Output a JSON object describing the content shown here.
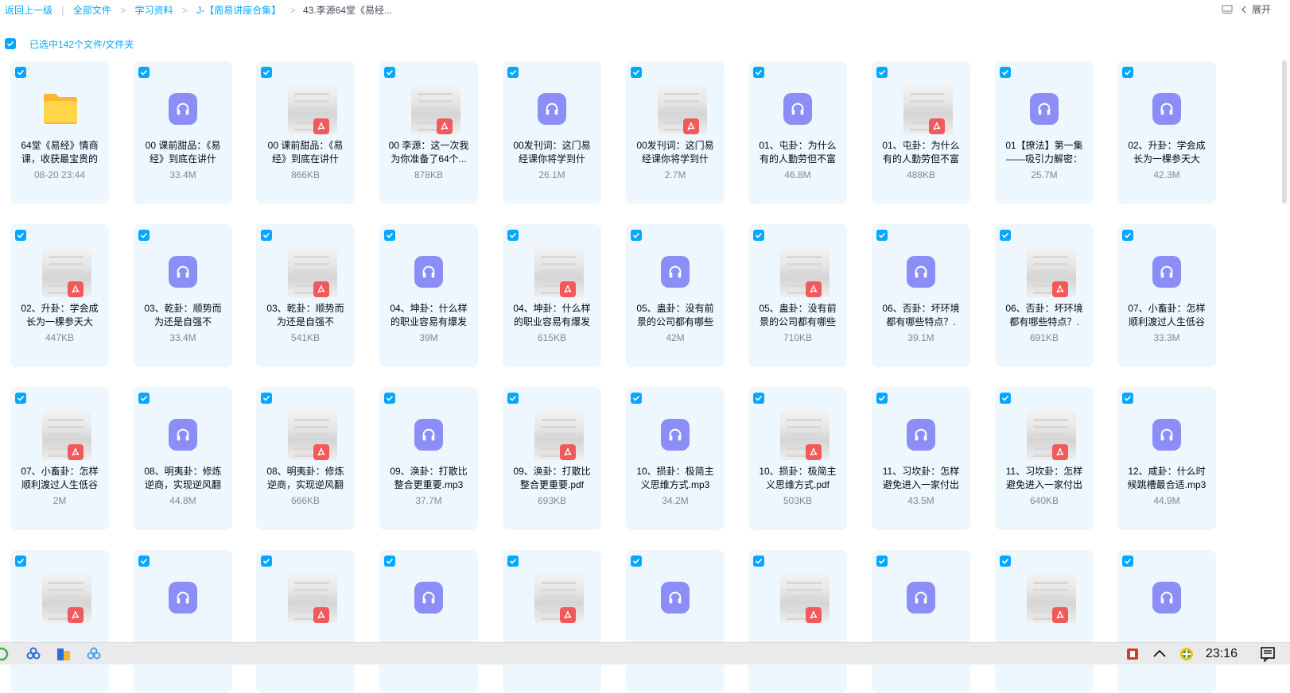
{
  "breadcrumb": {
    "back": "返回上一级",
    "items": [
      "全部文件",
      "学习资料",
      "J-【周易讲座合集】"
    ],
    "current": "43.李源64堂《易经..."
  },
  "top_right": {
    "collapse_label": "展开"
  },
  "selection": {
    "text": "已选中142个文件/文件夹"
  },
  "colors": {
    "accent": "#06a7ff",
    "card_bg": "#eef7fe",
    "audio_icon": "#8a8ef6",
    "pdf": "#f15a5a",
    "folder": "#ffc53d"
  },
  "files": [
    {
      "type": "folder",
      "name": "64堂《易经》情商课，收获最宝贵的",
      "meta": "08-20 23:44"
    },
    {
      "type": "audio",
      "name": "00 课前甜品：《易经》到底在讲什",
      "meta": "33.4M"
    },
    {
      "type": "pdf",
      "name": "00 课前甜品：《易经》到底在讲什",
      "meta": "866KB"
    },
    {
      "type": "pdf",
      "name": "00 李源：这一次我为你准备了64个...",
      "meta": "878KB"
    },
    {
      "type": "audio",
      "name": "00发刊词：这门易经课你将学到什",
      "meta": "26.1M"
    },
    {
      "type": "pdf",
      "name": "00发刊词：这门易经课你将学到什",
      "meta": "2.7M"
    },
    {
      "type": "audio",
      "name": "01、屯卦：为什么有的人勤劳但不富",
      "meta": "46.8M"
    },
    {
      "type": "pdf",
      "name": "01、屯卦：为什么有的人勤劳但不富",
      "meta": "488KB"
    },
    {
      "type": "audio",
      "name": "01【撩法】第一集——吸引力解密：",
      "meta": "25.7M"
    },
    {
      "type": "audio",
      "name": "02、升卦：学会成长为一棵参天大",
      "meta": "42.3M"
    },
    {
      "type": "pdf",
      "name": "02、升卦：学会成长为一棵参天大",
      "meta": "447KB"
    },
    {
      "type": "audio",
      "name": "03、乾卦：顺势而为还是自强不",
      "meta": "33.4M"
    },
    {
      "type": "pdf",
      "name": "03、乾卦：顺势而为还是自强不",
      "meta": "541KB"
    },
    {
      "type": "audio",
      "name": "04、坤卦：什么样的职业容易有爆发",
      "meta": "39M"
    },
    {
      "type": "pdf",
      "name": "04、坤卦：什么样的职业容易有爆发",
      "meta": "615KB"
    },
    {
      "type": "audio",
      "name": "05、蛊卦：没有前景的公司都有哪些",
      "meta": "42M"
    },
    {
      "type": "pdf",
      "name": "05、蛊卦：没有前景的公司都有哪些",
      "meta": "710KB"
    },
    {
      "type": "audio",
      "name": "06、否卦：坏环境都有哪些特点？.",
      "meta": "39.1M"
    },
    {
      "type": "pdf",
      "name": "06、否卦：坏环境都有哪些特点？.",
      "meta": "691KB"
    },
    {
      "type": "audio",
      "name": "07、小畜卦：怎样顺利渡过人生低谷",
      "meta": "33.3M"
    },
    {
      "type": "pdf",
      "name": "07、小畜卦：怎样顺利渡过人生低谷",
      "meta": "2M"
    },
    {
      "type": "audio",
      "name": "08、明夷卦：修炼逆商，实现逆风翻",
      "meta": "44.8M"
    },
    {
      "type": "pdf",
      "name": "08、明夷卦：修炼逆商，实现逆风翻",
      "meta": "666KB"
    },
    {
      "type": "audio",
      "name": "09、涣卦：打散比整合更重要.mp3",
      "meta": "37.7M"
    },
    {
      "type": "pdf",
      "name": "09、涣卦：打散比整合更重要.pdf",
      "meta": "693KB"
    },
    {
      "type": "audio",
      "name": "10、损卦：极简主义思维方式.mp3",
      "meta": "34.2M"
    },
    {
      "type": "pdf",
      "name": "10、损卦：极简主义思维方式.pdf",
      "meta": "503KB"
    },
    {
      "type": "audio",
      "name": "11、习坎卦：怎样避免进入一家付出",
      "meta": "43.5M"
    },
    {
      "type": "pdf",
      "name": "11、习坎卦：怎样避免进入一家付出",
      "meta": "640KB"
    },
    {
      "type": "audio",
      "name": "12、咸卦：什么时候跳槽最合适.mp3",
      "meta": "44.9M"
    },
    {
      "type": "pdf",
      "name": "",
      "meta": ""
    },
    {
      "type": "audio",
      "name": "",
      "meta": ""
    },
    {
      "type": "pdf",
      "name": "",
      "meta": ""
    },
    {
      "type": "audio",
      "name": "",
      "meta": ""
    },
    {
      "type": "pdf",
      "name": "",
      "meta": ""
    },
    {
      "type": "audio",
      "name": "",
      "meta": ""
    },
    {
      "type": "pdf",
      "name": "",
      "meta": ""
    },
    {
      "type": "audio",
      "name": "",
      "meta": ""
    },
    {
      "type": "pdf",
      "name": "",
      "meta": ""
    },
    {
      "type": "audio",
      "name": "",
      "meta": ""
    }
  ],
  "taskbar": {
    "time": "23:16"
  }
}
